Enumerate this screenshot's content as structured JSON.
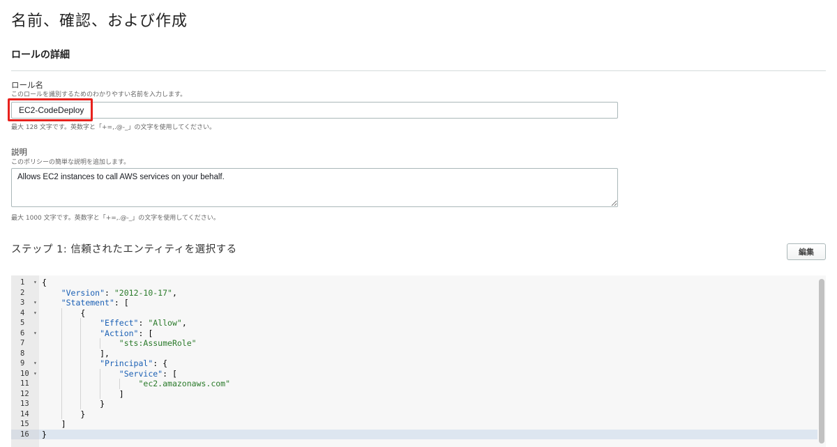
{
  "page": {
    "title": "名前、確認、および作成"
  },
  "role_details": {
    "section_title": "ロールの詳細",
    "role_name": {
      "label": "ロール名",
      "sublabel": "このロールを識別するためのわかりやすい名前を入力します。",
      "value": "EC2-CodeDeploy",
      "hint": "最大 128 文字です。英数字と「+=,.@-_」の文字を使用してください。"
    },
    "description": {
      "label": "説明",
      "sublabel": "このポリシーの簡単な説明を追加します。",
      "value": "Allows EC2 instances to call AWS services on your behalf.",
      "hint": "最大 1000 文字です。英数字と「+=,.@-_」の文字を使用してください。"
    }
  },
  "step1": {
    "title": "ステップ 1: 信頼されたエンティティを選択する",
    "edit_label": "編集",
    "code_lines": [
      {
        "n": "1",
        "fold": true,
        "text": "{"
      },
      {
        "n": "2",
        "fold": false,
        "text": "    \"Version\": \"2012-10-17\","
      },
      {
        "n": "3",
        "fold": true,
        "text": "    \"Statement\": ["
      },
      {
        "n": "4",
        "fold": true,
        "text": "        {"
      },
      {
        "n": "5",
        "fold": false,
        "text": "            \"Effect\": \"Allow\","
      },
      {
        "n": "6",
        "fold": true,
        "text": "            \"Action\": ["
      },
      {
        "n": "7",
        "fold": false,
        "text": "                \"sts:AssumeRole\""
      },
      {
        "n": "8",
        "fold": false,
        "text": "            ],"
      },
      {
        "n": "9",
        "fold": true,
        "text": "            \"Principal\": {"
      },
      {
        "n": "10",
        "fold": true,
        "text": "                \"Service\": ["
      },
      {
        "n": "11",
        "fold": false,
        "text": "                    \"ec2.amazonaws.com\""
      },
      {
        "n": "12",
        "fold": false,
        "text": "                ]"
      },
      {
        "n": "13",
        "fold": false,
        "text": "            }"
      },
      {
        "n": "14",
        "fold": false,
        "text": "        }"
      },
      {
        "n": "15",
        "fold": false,
        "text": "    ]"
      },
      {
        "n": "16",
        "fold": false,
        "text": "}"
      }
    ]
  },
  "colors": {
    "highlight_border": "#e8211d",
    "json_key": "#1a5fb4",
    "json_string": "#2a7a2a"
  }
}
